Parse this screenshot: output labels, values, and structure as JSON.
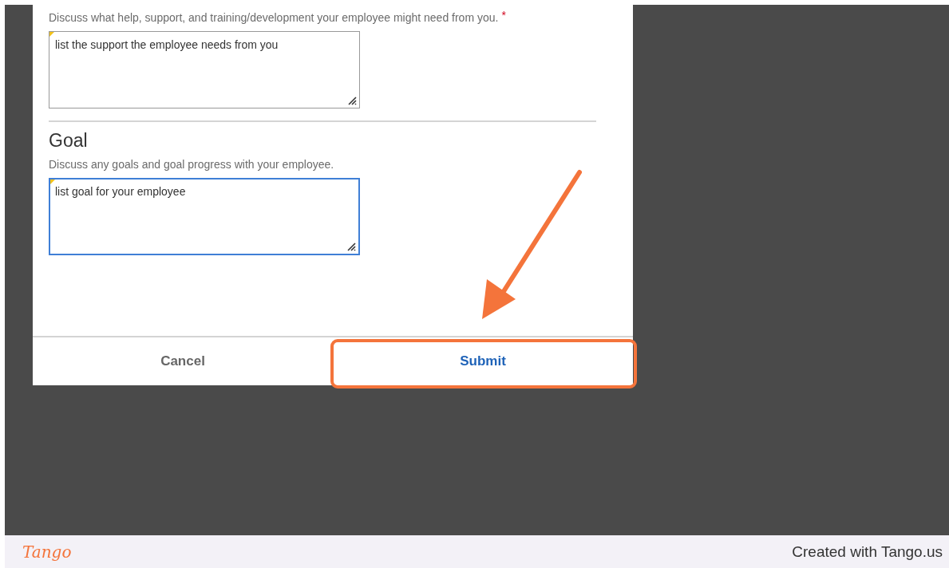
{
  "dialog": {
    "sections": [
      {
        "description": "Discuss what help, support, and training/development your employee might need from you.",
        "required": true,
        "value": "list the support the employee needs from you",
        "focused": false
      },
      {
        "heading": "Goal",
        "description": "Discuss any goals and goal progress with your employee.",
        "required": false,
        "value": "list goal for your employee",
        "focused": true
      }
    ],
    "buttons": [
      {
        "label": "Cancel",
        "kind": "secondary",
        "highlighted": false
      },
      {
        "label": "Submit",
        "kind": "primary",
        "highlighted": true
      }
    ],
    "required_mark": "*"
  },
  "footer": {
    "logo": "Tango",
    "credit": "Created with Tango.us"
  }
}
